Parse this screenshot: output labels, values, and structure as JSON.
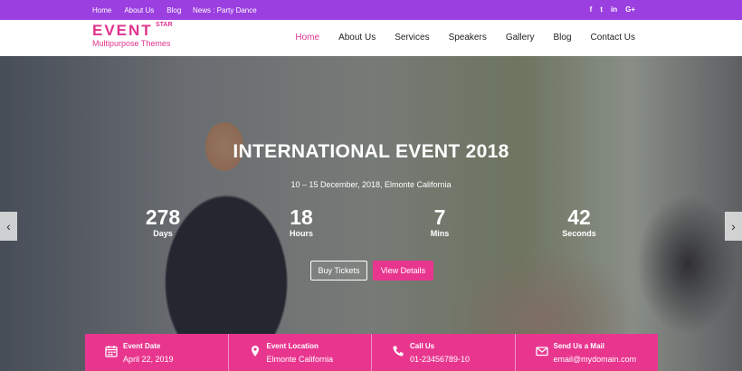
{
  "topbar": {
    "links": [
      "Home",
      "About Us",
      "Blog"
    ],
    "news": "News : Party Dance",
    "social": [
      "f",
      "t",
      "in",
      "G+"
    ]
  },
  "header": {
    "logo_main": "EVENT",
    "logo_star": "STAR",
    "logo_sub": "Multipurpose Themes",
    "nav": [
      "Home",
      "About Us",
      "Services",
      "Speakers",
      "Gallery",
      "Blog",
      "Contact Us"
    ],
    "active_nav": "Home"
  },
  "hero": {
    "title": "INTERNATIONAL EVENT 2018",
    "subtitle": "10 – 15 December, 2018, Elmonte California",
    "counters": [
      {
        "value": "278",
        "label": "Days"
      },
      {
        "value": "18",
        "label": "Hours"
      },
      {
        "value": "7",
        "label": "Mins"
      },
      {
        "value": "42",
        "label": "Seconds"
      }
    ],
    "buttons": {
      "outline": "Buy Tickets",
      "fill": "View Details"
    },
    "arrows": {
      "left": "‹",
      "right": "›"
    }
  },
  "info": [
    {
      "icon": "calendar-icon",
      "title": "Event Date",
      "value": "April 22, 2019"
    },
    {
      "icon": "location-pin-icon",
      "title": "Event Location",
      "value": "Elmonte California"
    },
    {
      "icon": "phone-icon",
      "title": "Call Us",
      "value": "01-23456789-10"
    },
    {
      "icon": "envelope-icon",
      "title": "Send Us a Mail",
      "value": "email@mydomain.com"
    }
  ],
  "colors": {
    "topbar": "#9b3fe0",
    "accent": "#e8368f"
  }
}
